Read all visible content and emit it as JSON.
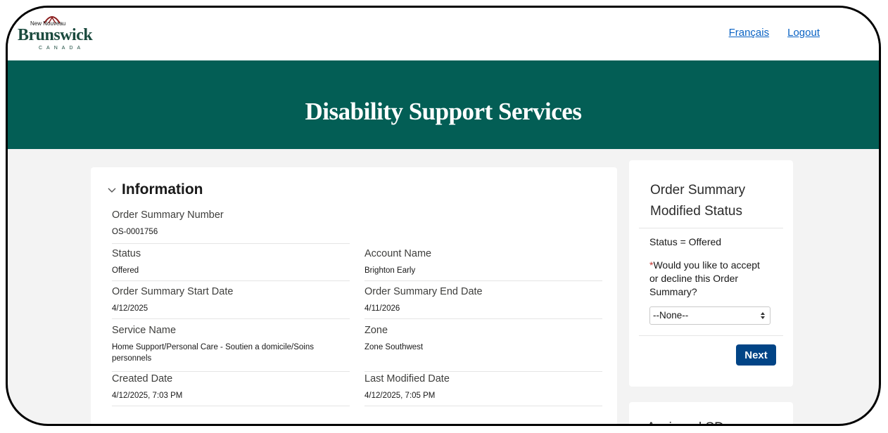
{
  "header": {
    "logo": {
      "small_text": "New Nouveau",
      "main_text": "Brunswick",
      "sub_text": "CANADA"
    },
    "links": {
      "french": "Français",
      "logout": "Logout"
    }
  },
  "banner": {
    "title": "Disability Support Services"
  },
  "information": {
    "section_title": "Information",
    "fields": {
      "order_summary_number": {
        "label": "Order Summary Number",
        "value": "OS-0001756"
      },
      "status": {
        "label": "Status",
        "value": "Offered"
      },
      "account_name": {
        "label": "Account Name",
        "value": "Brighton Early"
      },
      "start_date": {
        "label": "Order Summary Start Date",
        "value": "4/12/2025"
      },
      "end_date": {
        "label": "Order Summary End Date",
        "value": "4/11/2026"
      },
      "service_name": {
        "label": "Service Name",
        "value": "Home Support/Personal Care - Soutien a domicile/Soins personnels"
      },
      "zone": {
        "label": "Zone",
        "value": "Zone Southwest"
      },
      "created_date": {
        "label": "Created Date",
        "value": "4/12/2025, 7:03 PM"
      },
      "last_modified": {
        "label": "Last Modified Date",
        "value": "4/12/2025, 7:05 PM"
      }
    }
  },
  "status_panel": {
    "title": "Order Summary Modified Status",
    "status_text": "Status = Offered",
    "required_marker": "*",
    "question": "Would you like to accept or decline this Order Summary?",
    "select_value": "--None--",
    "next_label": "Next"
  },
  "assigned_panel": {
    "title": "Assigned SD"
  },
  "colors": {
    "banner": "#035e55",
    "link": "#0b63c4",
    "button": "#014486",
    "required": "#c23934"
  }
}
